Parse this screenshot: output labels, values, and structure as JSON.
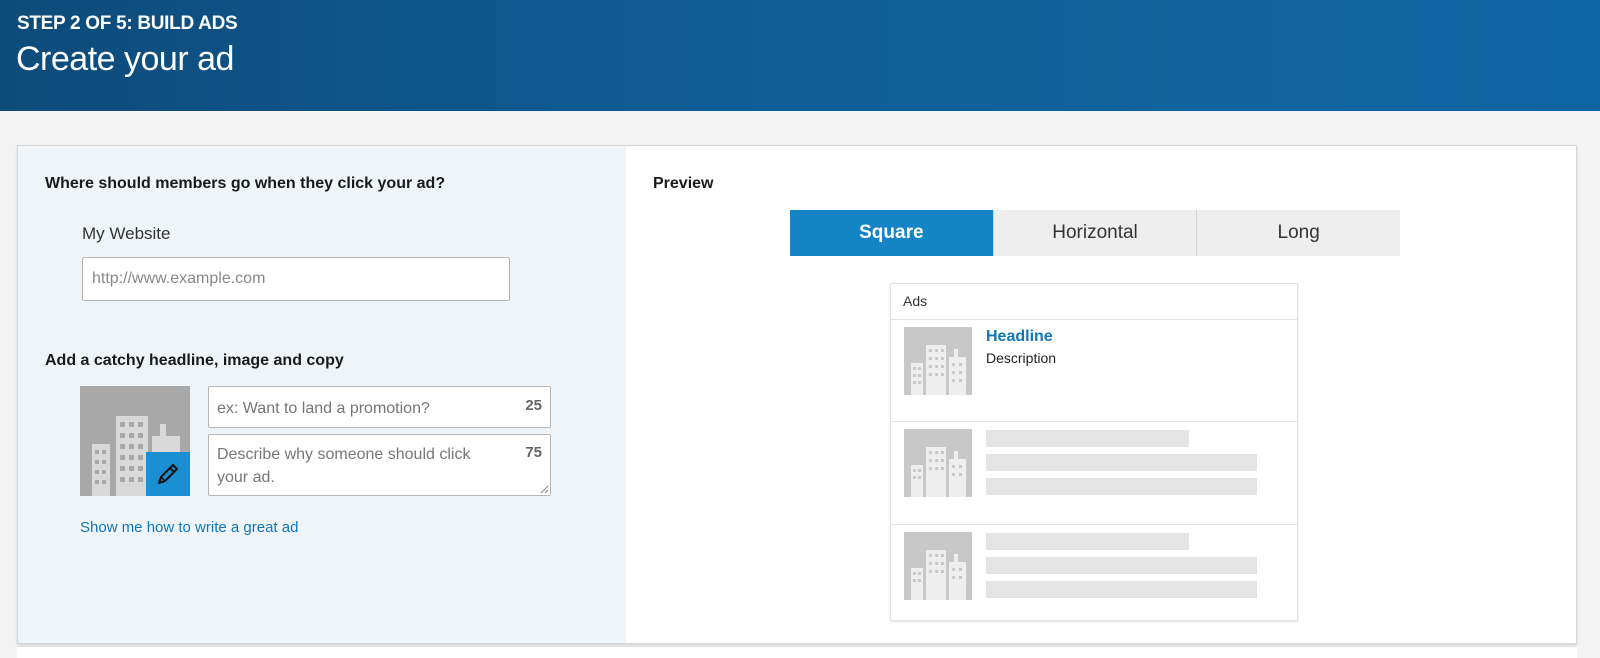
{
  "header": {
    "step": "STEP 2 OF 5: BUILD ADS",
    "title": "Create your ad"
  },
  "destination": {
    "question": "Where should members go when they click your ad?",
    "option_label": "My Website",
    "url_placeholder": "http://www.example.com",
    "url_value": ""
  },
  "creative": {
    "section_title": "Add a catchy headline, image and copy",
    "headline_placeholder": "ex: Want to land a promotion?",
    "headline_remaining": "25",
    "description_placeholder": "Describe why someone should click your ad.",
    "description_remaining": "75",
    "help_link": "Show me how to write a great ad",
    "edit_icon": "pencil-icon"
  },
  "preview": {
    "label": "Preview",
    "tabs": [
      {
        "label": "Square",
        "active": true
      },
      {
        "label": "Horizontal",
        "active": false
      },
      {
        "label": "Long",
        "active": false
      }
    ],
    "ads_label": "Ads",
    "ad_headline": "Headline",
    "ad_description": "Description"
  },
  "colors": {
    "header_blue": "#0f5d97",
    "accent_blue": "#1584c4",
    "link_blue": "#1176b6"
  }
}
